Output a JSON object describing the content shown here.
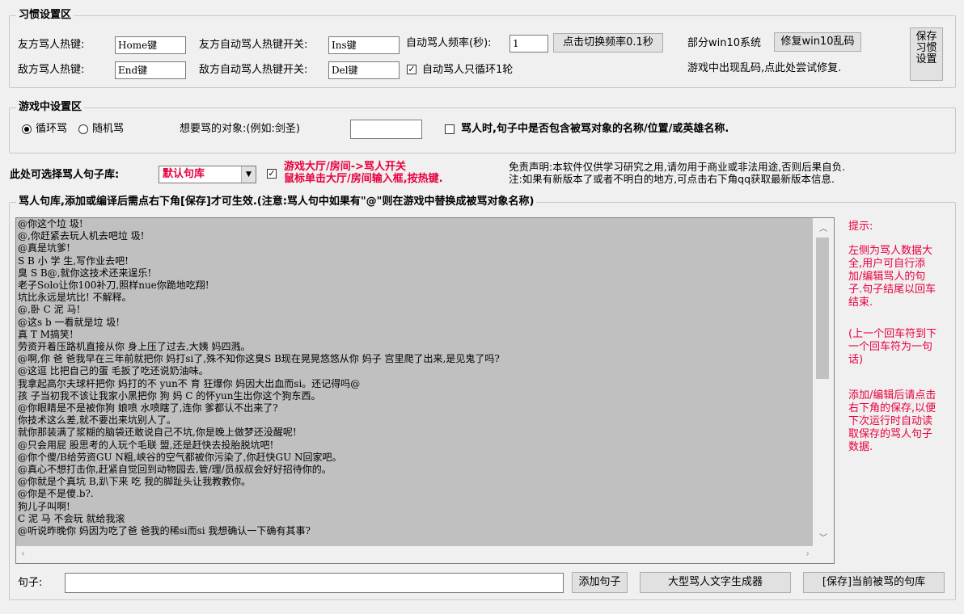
{
  "habit_section": {
    "title": "习惯设置区",
    "friendly_hotkey_label": "友方骂人热键:",
    "friendly_hotkey_value": "Home键",
    "enemy_hotkey_label": "敌方骂人热键:",
    "enemy_hotkey_value": "End键",
    "friendly_auto_toggle_label": "友方自动骂人热键开关:",
    "friendly_auto_toggle_value": "Ins键",
    "enemy_auto_toggle_label": "敌方自动骂人热键开关:",
    "enemy_auto_toggle_value": "Del键",
    "frequency_label": "自动骂人频率(秒):",
    "frequency_value": "1",
    "switch_frequency_button": "点击切换频率0.1秒",
    "loop_once_label": "自动骂人只循环1轮",
    "win10_label": "部分win10系统",
    "win10_fix_button": "修复win10乱码",
    "garble_hint": "游戏中出现乱码,点此处尝试修复.",
    "save_settings_button": "保存习惯设置"
  },
  "game_section": {
    "title": "游戏中设置区",
    "radio_loop": "循环骂",
    "radio_random": "随机骂",
    "target_label": "想要骂的对象:(例如:剑圣)",
    "target_value": "",
    "include_target_label": "骂人时,句子中是否包含被骂对象的名称/位置/或英雄名称."
  },
  "library_select": {
    "label": "此处可选择骂人句子库:",
    "selected": "默认句库",
    "hall_switch_line1": "游戏大厅/房间->骂人开关",
    "hall_switch_line2": "鼠标单击大厅/房间输入框,按热键.",
    "disclaimer_line1": "免责声明:本软件仅供学习研究之用,请勿用于商业或非法用途,否则后果自负.",
    "disclaimer_line2": "注:如果有新版本了或者不明白的地方,可点击右下角qq获取最新版本信息."
  },
  "library_section": {
    "title": "骂人句库,添加或编译后需点右下角[保存]才可生效.(注意:骂人句中如果有\"@\"则在游戏中替换成被骂对象名称)",
    "lines": [
      "@你这个垃 圾!",
      "@,你赶紧去玩人机去吧垃 圾!",
      "@真是坑爹!",
      "S B 小 学 生,写作业去吧!",
      "臭 S B@,就你这技术还来逞乐!",
      "老子Solo让你100补刀,照样nue你跪地吃翔!",
      "坑比永远是坑比! 不解释。",
      "@,卧 C 泥 马!",
      "@这s b 一看就是垃 圾!",
      "真 T M搞笑!",
      "劳资开着压路机直接从你 身上压了过去,大姨 妈四溅。",
      "@啊,你 爸 爸我早在三年前就把你 妈打si了,殊不知你这臭S B现在晃晃悠悠从你 妈子 宫里爬了出来,是见鬼了吗?",
      "@这逗 比把自己的蛋 毛扳了吃还说奶油味。",
      "我拿起高尔夫球杆把你 妈打的不 yun不 育 狂爆你 妈因大出血而si。还记得吗@",
      "孩 子当初我不该让我家小黑把你 狗 妈 C 的怀yun生出你这个狗东西。",
      "@你眼睛是不是被你狗 娘喷 水喷瞎了,连你 爹都认不出来了?",
      "你技术这么差,就不要出来坑别人了。",
      "就你那装满了浆糊的脑袋还敢说自己不坑,你是晚上做梦还没醒呢!",
      "@只会用屁 股思考的人玩个毛联 盟,还是赶快去投胎脱坑吧!",
      "@你个傻/B给劳资GU N粗,峡谷的空气都被你污染了,你赶快GU N回家吧。",
      "@真心不想打击你,赶紧自觉回到动物园去,管/理/员叔叔会好好招待你的。",
      "@你就是个真坑 B,趴下来 吃 我的脚趾头让我教教你。",
      "@你是不是傻.b?.",
      "狗儿子叫啊!",
      "C 泥 马 不会玩 就给我滚",
      "@听说昨晚你 妈因为吃了爸 爸我的稀si而si 我想确认一下确有其事?"
    ]
  },
  "tips": {
    "title": "提示:",
    "para1": "左侧为骂人数据大全,用户可自行添加/编辑骂人的句子.句子结尾以回车结束.",
    "para2": "(上一个回车符到下一个回车符为一句话)",
    "para3": "添加/编辑后请点击右下角的保存,以便下次运行时自动读取保存的骂人句子数据."
  },
  "bottom": {
    "sentence_label": "句子:",
    "sentence_value": "",
    "add_button": "添加句子",
    "generator_button": "大型骂人文字生成器",
    "save_button": "[保存]当前被骂的句库"
  },
  "colors": {
    "accent_red": "#e8003c",
    "list_bg": "#c0c0c0",
    "window_bg": "#f0f0f0"
  },
  "icons": [
    "chevron-up-icon",
    "chevron-down-icon",
    "chevron-left-icon",
    "chevron-right-icon",
    "dropdown-arrow-icon",
    "checkmark-icon"
  ]
}
